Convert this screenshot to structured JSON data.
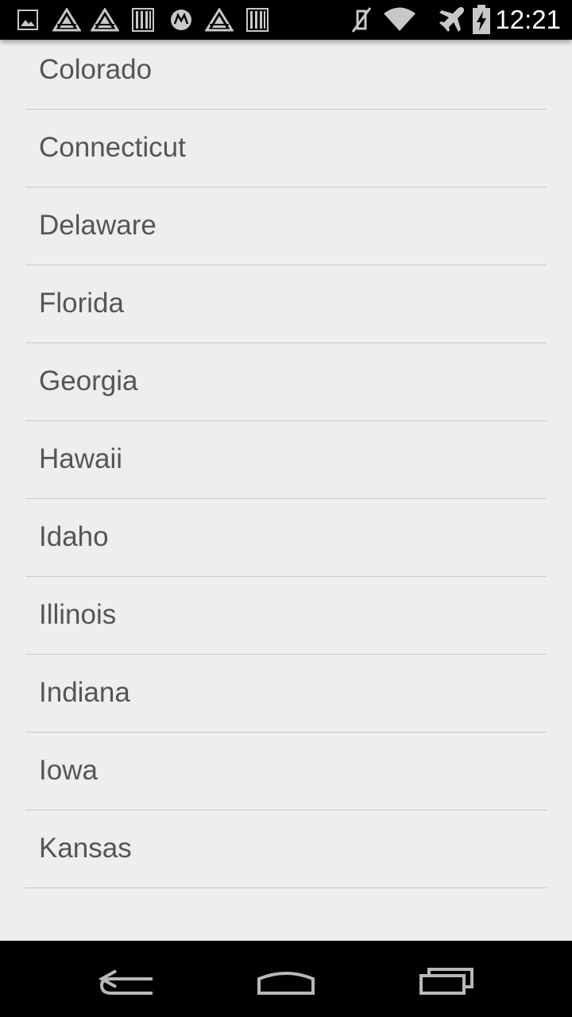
{
  "status_bar": {
    "time": "12:21",
    "left_icons": [
      "image-icon",
      "triangle-app-icon",
      "triangle-app-icon",
      "barcode-icon",
      "motorola-icon",
      "triangle-app-icon",
      "barcode-icon"
    ],
    "right_icons": [
      "mute-icon",
      "wifi-icon",
      "airplane-icon",
      "battery-charging-icon"
    ]
  },
  "list": {
    "items": [
      {
        "label": "Colorado"
      },
      {
        "label": "Connecticut"
      },
      {
        "label": "Delaware"
      },
      {
        "label": "Florida"
      },
      {
        "label": "Georgia"
      },
      {
        "label": "Hawaii"
      },
      {
        "label": "Idaho"
      },
      {
        "label": "Illinois"
      },
      {
        "label": "Indiana"
      },
      {
        "label": "Iowa"
      },
      {
        "label": "Kansas"
      }
    ]
  },
  "nav_bar": {
    "buttons": [
      "back-icon",
      "home-icon",
      "recents-icon"
    ]
  },
  "colors": {
    "background": "#eeeeee",
    "text": "#555555",
    "divider": "#c8c8c8",
    "bar": "#000000"
  }
}
